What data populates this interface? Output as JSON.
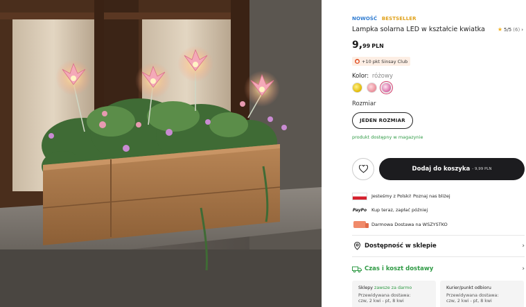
{
  "product": {
    "tag_new": "NOWOŚĆ",
    "tag_bestseller": "BESTSELLER",
    "title": "Lampka solarna LED w kształcie kwiatka",
    "rating_score": "5/5",
    "rating_count": "(6)",
    "price_int": "9,",
    "price_dec": "99",
    "price_currency": "PLN"
  },
  "club": {
    "label": "+10 pkt Sinsay Club"
  },
  "color": {
    "label": "Kolor:",
    "value": "różowy",
    "swatches": [
      "yellow",
      "pink",
      "pink-striped"
    ],
    "selected_index": 2
  },
  "size": {
    "label": "Rozmiar",
    "option": "JEDEN ROZMIAR"
  },
  "availability": "produkt dostępny w magazynie",
  "cart": {
    "button_label": "Dodaj do koszyka",
    "button_price": "- 9,99 PLN"
  },
  "info": {
    "polish": "Jesteśmy z Polski! Poznaj nas bliżej",
    "paypo_logo": "PayPo",
    "paypo": "Kup teraz, zapłać później",
    "delivery": "Darmowa Dostawa na WSZYSTKO"
  },
  "links": {
    "store_availability": "Dostępność w sklepie",
    "delivery_time": "Czas i koszt dostawy"
  },
  "delivery_cards": [
    {
      "title": "Sklepy",
      "highlight": "zawsze za darmo",
      "expected": "Przewidywana dostawa:",
      "days": "czw, 2 kwi - pt, 8 kwi"
    },
    {
      "title": "Kurier/punkt odbioru",
      "highlight": "",
      "expected": "Przewidywana dostawa:",
      "days": "czw, 2 kwi - pt, 8 kwi"
    }
  ],
  "colors": {
    "accent_dark": "#1c1c1f",
    "tag_new": "#2e7bd1",
    "tag_bestseller": "#e0a11a",
    "available_green": "#2e9a44"
  },
  "icons": [
    "heart-icon",
    "pin-icon",
    "truck-icon",
    "chevron-right-icon",
    "star-icon"
  ]
}
